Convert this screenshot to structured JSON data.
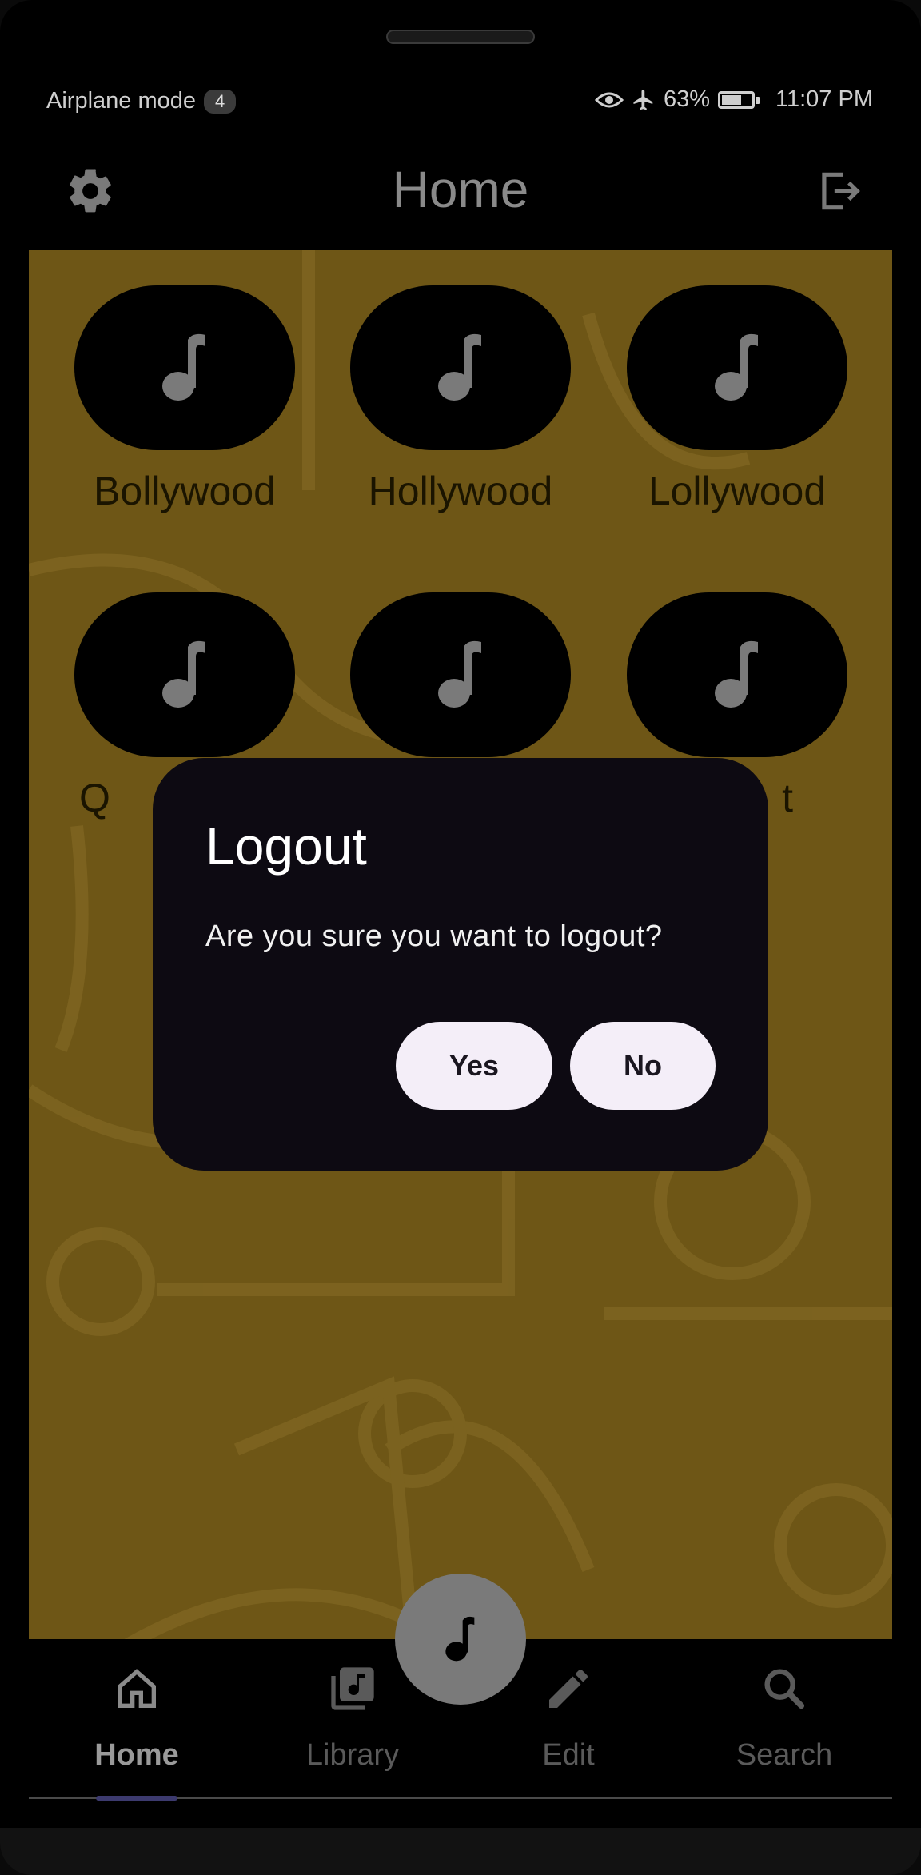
{
  "status_bar": {
    "left_text": "Airplane mode",
    "badge": "4",
    "battery": "63%",
    "time": "11:07 PM"
  },
  "app_bar": {
    "title": "Home"
  },
  "genres": [
    {
      "label": "Bollywood"
    },
    {
      "label": "Hollywood"
    },
    {
      "label": "Lollywood"
    },
    {
      "label": "Q"
    },
    {
      "label": ""
    },
    {
      "label": "t"
    }
  ],
  "dialog": {
    "title": "Logout",
    "message": "Are you sure you want to logout?",
    "yes_label": "Yes",
    "no_label": "No"
  },
  "bottom_nav": {
    "items": [
      {
        "label": "Home",
        "icon": "home-icon",
        "active": true
      },
      {
        "label": "Library",
        "icon": "library-music-icon",
        "active": false
      },
      {
        "label": "Edit",
        "icon": "pencil-icon",
        "active": false
      },
      {
        "label": "Search",
        "icon": "search-icon",
        "active": false
      }
    ]
  },
  "colors": {
    "background_pattern": "#6e5616",
    "dialog_bg": "#0d0a12",
    "button_bg": "#f4eef8",
    "nav_indicator": "#3c3a6e"
  }
}
